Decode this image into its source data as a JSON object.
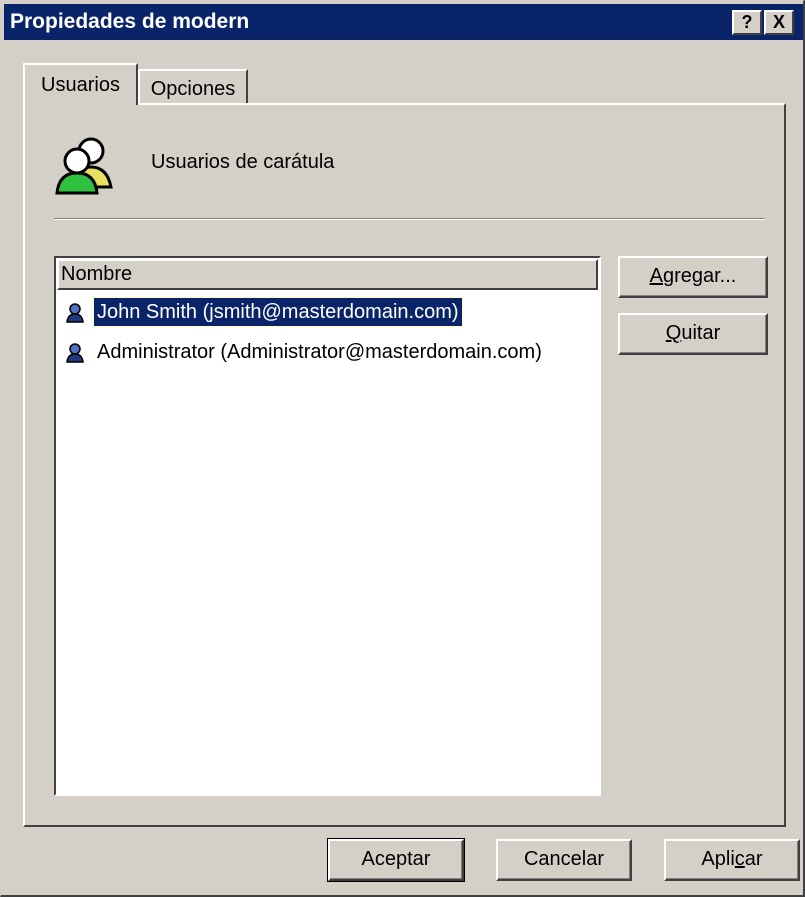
{
  "window": {
    "title": "Propiedades de modern",
    "help_button": "?",
    "close_button": "X"
  },
  "tabs": [
    {
      "label": "Usuarios",
      "active": true
    },
    {
      "label": "Opciones",
      "active": false
    }
  ],
  "section": {
    "heading": "Usuarios de carátula",
    "icon": "users-group-icon"
  },
  "list": {
    "column_header": "Nombre",
    "rows": [
      {
        "text": "John Smith (jsmith@masterdomain.com)",
        "selected": true,
        "icon": "user-icon"
      },
      {
        "text": "Administrator (Administrator@masterdomain.com)",
        "selected": false,
        "icon": "user-icon"
      }
    ]
  },
  "side_buttons": {
    "add": {
      "accel": "A",
      "rest": "gregar..."
    },
    "remove": {
      "accel": "Q",
      "rest": "uitar"
    }
  },
  "footer": {
    "ok": "Aceptar",
    "cancel": "Cancelar",
    "apply_pre": "Apli",
    "apply_accel": "c",
    "apply_post": "ar"
  },
  "colors": {
    "titlebar": "#0a246a",
    "face": "#d4d0c8",
    "selection": "#0a246a"
  }
}
